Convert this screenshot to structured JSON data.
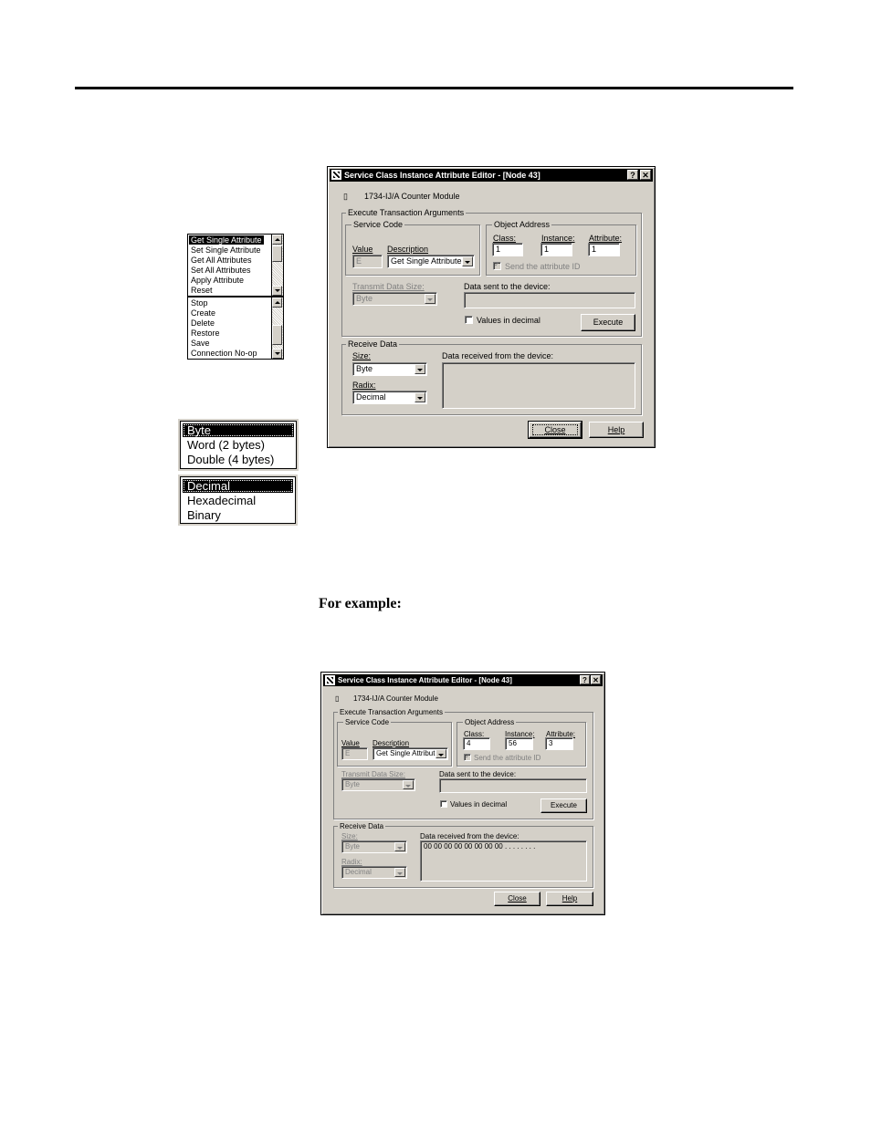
{
  "service_list": {
    "items": [
      "Get Single Attribute",
      "Set Single Attribute",
      "Get All Attributes",
      "Set All Attributes",
      "Apply Attribute",
      "Reset",
      "Stop",
      "Create",
      "Delete",
      "Restore",
      "Save",
      "Connection No-op"
    ]
  },
  "size_list": {
    "items": [
      "Byte",
      "Word (2 bytes)",
      "Double (4 bytes)"
    ]
  },
  "radix_list": {
    "items": [
      "Decimal",
      "Hexadecimal",
      "Binary"
    ]
  },
  "example_heading": "For example:",
  "dialog1": {
    "title": "Service Class Instance Attribute Editor - [Node 43]",
    "help_btn": "?",
    "close_btn": "✕",
    "device_name": "1734-IJ/A Counter Module",
    "execute_group": "Execute Transaction Arguments",
    "service_code_group": "Service Code",
    "value_label": "Value",
    "value": "E",
    "description_label": "Description",
    "description": "Get Single Attribute",
    "object_address_group": "Object Address",
    "class_label": "Class:",
    "class_value": "1",
    "instance_label": "Instance:",
    "instance_value": "1",
    "attribute_label": "Attribute:",
    "attribute_value": "1",
    "send_attr_id": "Send the attribute ID",
    "transmit_size_label": "Transmit Data Size:",
    "transmit_size": "Byte",
    "data_sent_label": "Data sent to the device:",
    "data_sent": "",
    "values_decimal": "Values in decimal",
    "execute": "Execute",
    "receive_group": "Receive Data",
    "size_label": "Size:",
    "size_value": "Byte",
    "data_received_label": "Data received from the device:",
    "data_received": "",
    "radix_label": "Radix:",
    "radix_value": "Decimal",
    "close": "Close",
    "help": "Help"
  },
  "dialog2": {
    "title": "Service Class Instance Attribute Editor - [Node 43]",
    "help_btn": "?",
    "close_btn": "✕",
    "device_name": "1734-IJ/A Counter Module",
    "execute_group": "Execute Transaction Arguments",
    "service_code_group": "Service Code",
    "value_label": "Value",
    "value": "E",
    "description_label": "Description",
    "description": "Get Single Attribute",
    "object_address_group": "Object Address",
    "class_label": "Class:",
    "class_value": "4",
    "instance_label": "Instance:",
    "instance_value": "56",
    "attribute_label": "Attribute:",
    "attribute_value": "3",
    "send_attr_id": "Send the attribute ID",
    "transmit_size_label": "Transmit Data Size:",
    "transmit_size": "Byte",
    "data_sent_label": "Data sent to the device:",
    "data_sent": "",
    "values_decimal": "Values in decimal",
    "execute": "Execute",
    "receive_group": "Receive Data",
    "size_label": "Size:",
    "size_value": "Byte",
    "data_received_label": "Data received from the device:",
    "data_received": "00 00 00 00 00 00 00 00     . . . . . . . .",
    "radix_label": "Radix:",
    "radix_value": "Decimal",
    "close": "Close",
    "help": "Help"
  }
}
